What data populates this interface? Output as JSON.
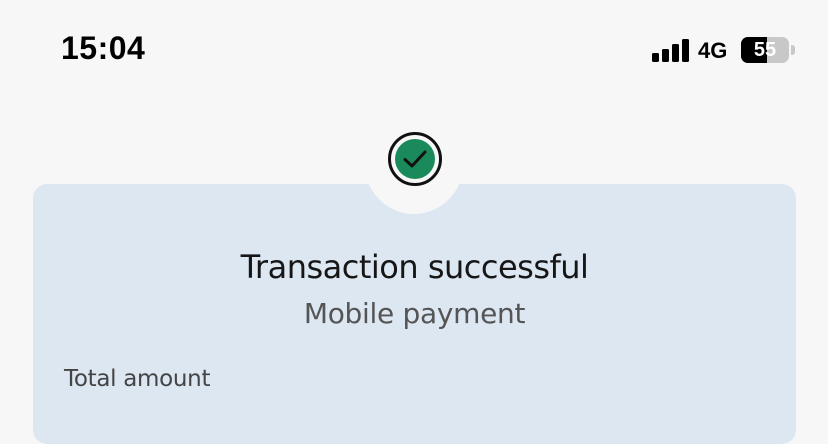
{
  "status_bar": {
    "time": "15:04",
    "network": "4G",
    "battery_percent": "55",
    "battery_level": 0.55,
    "signal_bars": 4
  },
  "transaction": {
    "title": "Transaction successful",
    "subtitle": "Mobile payment",
    "total_label": "Total amount"
  },
  "icons": {
    "success": "checkmark-circle-icon"
  },
  "colors": {
    "background": "#f7f7f7",
    "card": "#dde7f2",
    "success": "#1a8a5a"
  }
}
